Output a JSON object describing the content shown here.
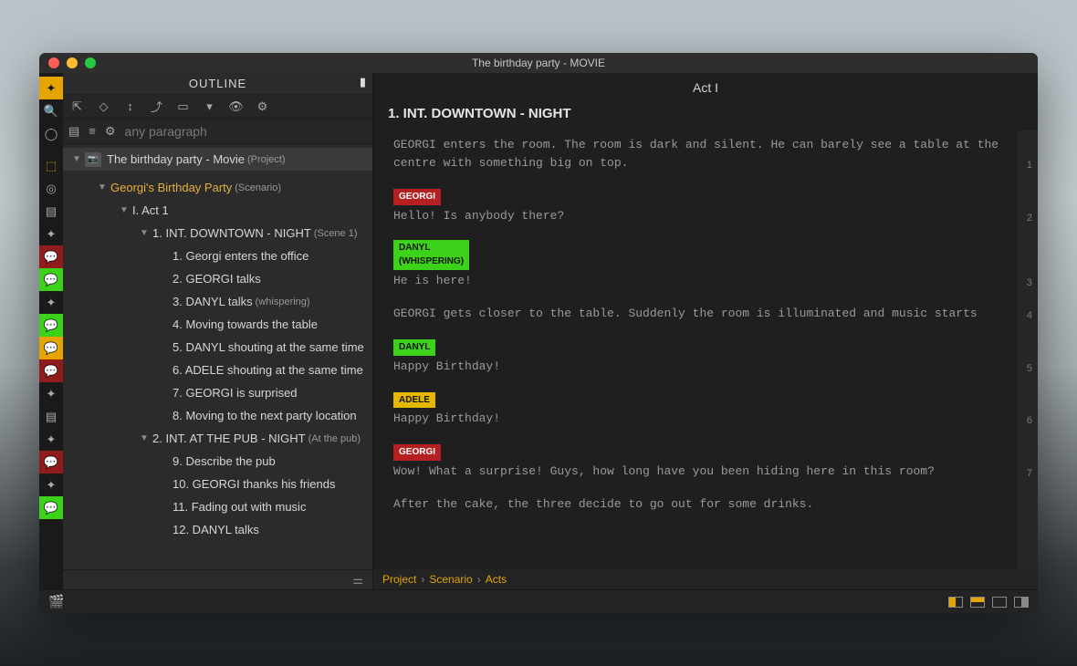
{
  "window_title": "The birthday party - MOVIE",
  "outline": {
    "header": "OUTLINE",
    "search": {
      "placeholder": "any paragraph"
    },
    "project": {
      "label": "The birthday party - Movie",
      "suffix": "(Project)"
    },
    "scenario": {
      "label": "Georgi's Birthday Party",
      "suffix": "(Scenario)"
    },
    "act": {
      "label": "I. Act 1"
    },
    "scenes": [
      {
        "heading": "1. INT.  DOWNTOWN - NIGHT",
        "suffix": "(Scene 1)",
        "items": [
          "1. Georgi enters the office",
          "2. GEORGI talks",
          "3. DANYL talks",
          "4. Moving towards the table",
          "5. DANYL shouting at the same time",
          "6. ADELE shouting at the same time",
          "7. GEORGI is surprised",
          "8. Moving to the next party location"
        ],
        "item_suffixes": [
          "",
          "",
          "(whispering)",
          "",
          "",
          "",
          "",
          ""
        ]
      },
      {
        "heading": "2. INT.  AT THE PUB - NIGHT",
        "suffix": "(At the pub)",
        "items": [
          "9. Describe the pub",
          "10. GEORGI thanks his friends",
          "11. Fading out with music",
          "12. DANYL talks"
        ],
        "item_suffixes": [
          "",
          "",
          "",
          ""
        ]
      }
    ]
  },
  "editor": {
    "act_label": "Act I",
    "scene_heading": "1. INT.  DOWNTOWN - NIGHT",
    "blocks": [
      {
        "type": "action",
        "text": "GEORGI enters the room. The room is dark and silent. He can barely see a table at the centre with something big on top.",
        "line": "1"
      },
      {
        "type": "dialog",
        "char": "GEORGI",
        "tag": "tag-georgi",
        "text": "Hello! Is anybody there?",
        "line": "2"
      },
      {
        "type": "dialog",
        "char": "DANYL",
        "tag": "tag-danyl",
        "paren": "(WHISPERING)",
        "text": "He is here!",
        "line": "3"
      },
      {
        "type": "action",
        "text": "GEORGI gets closer to the table. Suddenly the room is illuminated and music starts",
        "line": "4"
      },
      {
        "type": "dialog",
        "char": "DANYL",
        "tag": "tag-danyl",
        "text": "Happy Birthday!",
        "line": "5"
      },
      {
        "type": "dialog",
        "char": "ADELE",
        "tag": "tag-adele",
        "text": "Happy Birthday!",
        "line": "6"
      },
      {
        "type": "dialog",
        "char": "GEORGI",
        "tag": "tag-georgi",
        "text": "Wow! What a surprise! Guys, how long have you been hiding here in this room?",
        "line": "7"
      },
      {
        "type": "action",
        "text": "After the cake, the three decide to go out for some drinks."
      }
    ]
  },
  "breadcrumb": [
    "Project",
    "Scenario",
    "Acts"
  ]
}
